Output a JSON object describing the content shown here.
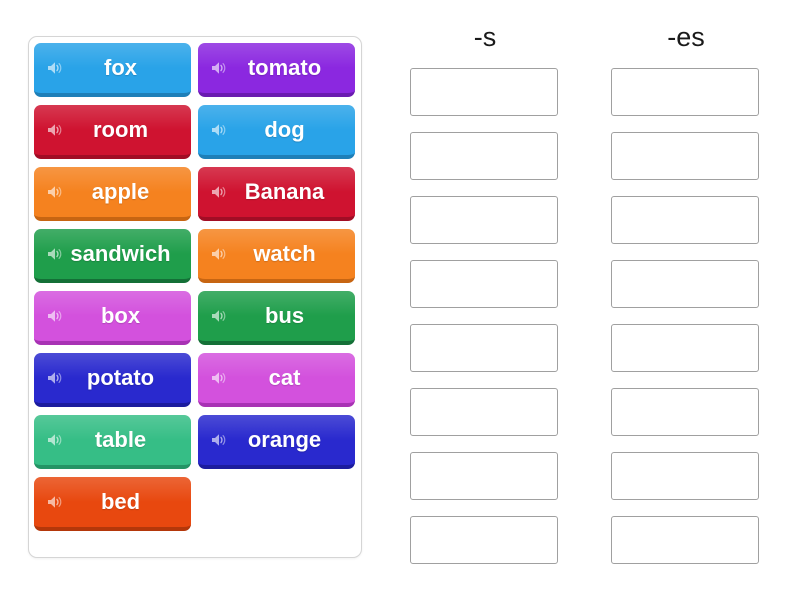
{
  "activity": {
    "type": "group-sort",
    "background_color": "#ffffff"
  },
  "word_bank": {
    "name": "word-bank",
    "tiles": [
      {
        "label": "fox",
        "color": "#29A3E8",
        "shade": "#1E7FB8",
        "icon": "speaker-icon"
      },
      {
        "label": "tomato",
        "color": "#8B28E0",
        "shade": "#6A1BB0",
        "icon": "speaker-icon"
      },
      {
        "label": "room",
        "color": "#CF1330",
        "shade": "#A10D25",
        "icon": "speaker-icon"
      },
      {
        "label": "dog",
        "color": "#29A3E8",
        "shade": "#1E7FB8",
        "icon": "speaker-icon"
      },
      {
        "label": "apple",
        "color": "#F5821F",
        "shade": "#C76512",
        "icon": "speaker-icon"
      },
      {
        "label": "Banana",
        "color": "#CF1330",
        "shade": "#A10D25",
        "icon": "speaker-icon"
      },
      {
        "label": "sandwich",
        "color": "#1F9E4B",
        "shade": "#147037",
        "icon": "speaker-icon"
      },
      {
        "label": "watch",
        "color": "#F5821F",
        "shade": "#C76512",
        "icon": "speaker-icon"
      },
      {
        "label": "box",
        "color": "#D351DD",
        "shade": "#A832B4",
        "icon": "speaker-icon"
      },
      {
        "label": "bus",
        "color": "#1F9E4B",
        "shade": "#147037",
        "icon": "speaker-icon"
      },
      {
        "label": "potato",
        "color": "#2929CE",
        "shade": "#1C1C9E",
        "icon": "speaker-icon"
      },
      {
        "label": "cat",
        "color": "#D351DD",
        "shade": "#A832B4",
        "icon": "speaker-icon"
      },
      {
        "label": "table",
        "color": "#36BE86",
        "shade": "#249465",
        "icon": "speaker-icon"
      },
      {
        "label": "orange",
        "color": "#2929CE",
        "shade": "#1C1C9E",
        "icon": "speaker-icon"
      },
      {
        "label": "bed",
        "color": "#E8480F",
        "shade": "#B4370A",
        "icon": "speaker-icon"
      }
    ]
  },
  "drop_columns": [
    {
      "header": "-s",
      "slots": [
        "",
        "",
        "",
        "",
        "",
        "",
        "",
        ""
      ]
    },
    {
      "header": "-es",
      "slots": [
        "",
        "",
        "",
        "",
        "",
        "",
        "",
        ""
      ]
    }
  ]
}
